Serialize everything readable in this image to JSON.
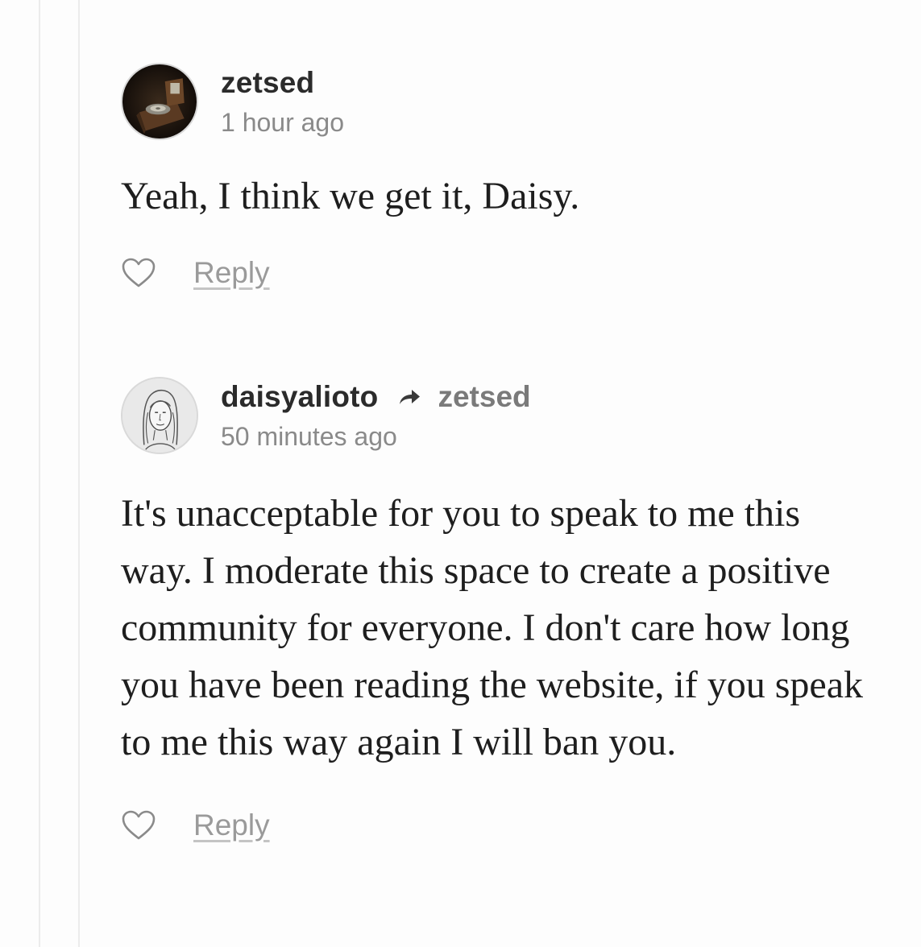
{
  "comments": [
    {
      "username": "zetsed",
      "reply_to": "",
      "timestamp": "1 hour ago",
      "text": "Yeah, I think we get it, Daisy.",
      "reply_label": "Reply",
      "avatar_icon": "gramophone-photo-icon"
    },
    {
      "username": "daisyalioto",
      "reply_to": "zetsed",
      "timestamp": "50 minutes ago",
      "text": "It's unacceptable for you to speak to me this way. I moderate this space to create a positive community for everyone. I don't care how long you have been reading the website, if you speak to me this way again I will ban you.",
      "reply_label": "Reply",
      "avatar_icon": "woman-sketch-portrait-icon"
    }
  ],
  "colors": {
    "username": "#2b2b2b",
    "secondary_text": "#8a8a8a",
    "body_text": "#1e1e1e",
    "thread_line": "#ececec"
  }
}
